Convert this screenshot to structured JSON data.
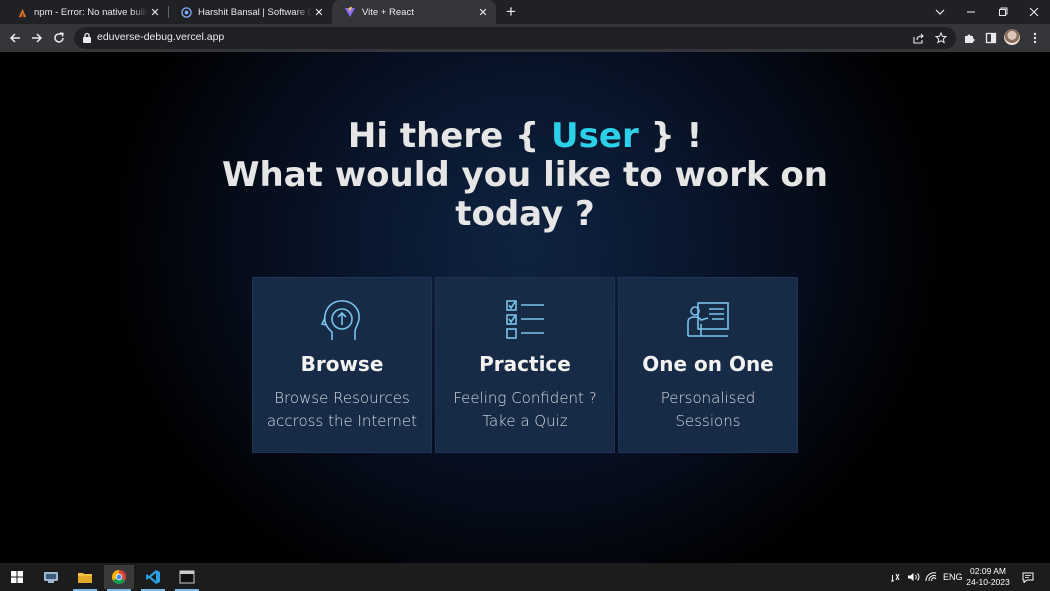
{
  "browser": {
    "tabs": [
      {
        "title": "npm - Error: No native build wa",
        "active": false,
        "favicon": "npm-icon"
      },
      {
        "title": "Harshit Bansal | Software Develo",
        "active": false,
        "favicon": "portfolio-icon"
      },
      {
        "title": "Vite + React",
        "active": true,
        "favicon": "vite-icon"
      }
    ],
    "url": "eduverse-debug.vercel.app"
  },
  "hero": {
    "greeting_prefix": "Hi there { ",
    "user_name": "User",
    "greeting_suffix": " } !",
    "question_line1": "What would you like to work on",
    "question_line2": "today ?",
    "accent_color": "#2bd1e8"
  },
  "cards": [
    {
      "title": "Browse",
      "line1": "Browse Resources",
      "line2": "accross the Internet",
      "icon": "head-upload-icon"
    },
    {
      "title": "Practice",
      "line1": "Feeling Confident ?",
      "line2": "Take a Quiz",
      "icon": "checklist-icon"
    },
    {
      "title": "One on One",
      "line1": "Personalised",
      "line2": "Sessions",
      "icon": "teacher-board-icon"
    }
  ],
  "taskbar": {
    "apps": [
      "start-icon",
      "file-manager-icon",
      "file-explorer-icon",
      "chrome-icon",
      "vscode-icon",
      "terminal-icon"
    ],
    "language": "ENG",
    "time": "02:09 AM",
    "date": "24-10-2023"
  }
}
